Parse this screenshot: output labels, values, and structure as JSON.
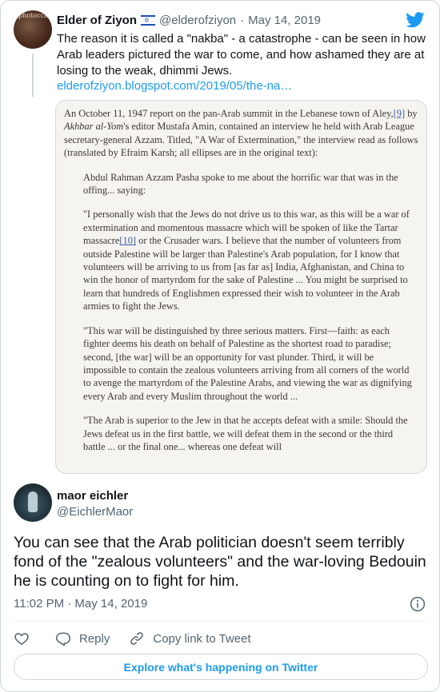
{
  "quoted": {
    "name": "Elder of Ziyon",
    "handle": "@elderofziyon",
    "separator": "·",
    "date": "May 14, 2019",
    "text": "The reason it is called a \"nakba\" - a catastrophe - can be seen in how Arab leaders pictured the war to come, and how ashamed they are at losing to the weak, dhimmi Jews.",
    "link": "elderofziyon.blogspot.com/2019/05/the-na…",
    "avatar_mark": "photocca"
  },
  "media": {
    "intro_a": "An October 11, 1947 report on the pan-Arab summit in the Lebanese town of Aley,",
    "intro_fn": "[9]",
    "intro_b": " by ",
    "intro_pub": "Akhbar al-Yom",
    "intro_c": "'s editor Mustafa Amin, contained an interview he held with Arab League secretary-general Azzam. Titled, \"A War of Extermination,\" the interview read as follows (translated by Efraim Karsh; all ellipses are in the original text):",
    "p1": "Abdul Rahman Azzam Pasha spoke to me about the horrific war that was in the offing... saying:",
    "p2a": "\"I personally wish that the Jews do not drive us to this war, as this will be a war of extermination and momentous massacre which will be spoken of like the Tartar massacre",
    "p2fn": "[10]",
    "p2b": " or the Crusader wars. I believe that the number of volunteers from outside Palestine will be larger than Palestine's Arab population, for I know that volunteers will be arriving to us from [as far as] India, Afghanistan, and China to win the honor of martyrdom for the sake of Palestine ... You might be surprised to learn that hundreds of Englishmen expressed their wish to volunteer in the Arab armies to fight the Jews.",
    "p3": "\"This war will be distinguished by three serious matters. First—faith: as each fighter deems his death on behalf of Palestine as the shortest road to paradise; second, [the war] will be an opportunity for vast plunder. Third, it will be impossible to contain the zealous volunteers arriving from all corners of the world to avenge the martyrdom of the Palestine Arabs, and viewing the war as dignifying every Arab and every Muslim throughout the world ...",
    "p4": "\"The Arab is superior to the Jew in that he accepts defeat with a smile: Should the Jews defeat us in the first battle, we will defeat them in the second or the third battle ... or the final one... whereas one defeat will"
  },
  "reply": {
    "name": "maor eichler",
    "handle": "@EichlerMaor",
    "text": "You can see that the Arab politician doesn't seem terribly fond of the \"zealous volunteers\" and the war-loving Bedouin he is counting on to fight for him.",
    "timestamp": "11:02 PM · May 14, 2019"
  },
  "actions": {
    "reply_label": "Reply",
    "copy_label": "Copy link to Tweet"
  },
  "explore_label": "Explore what's happening on Twitter",
  "icons": [
    "twitter-bird-icon",
    "israel-flag-icon",
    "info-icon",
    "heart-icon",
    "reply-icon",
    "link-icon"
  ],
  "colors": {
    "accent": "#1d9bf0",
    "muted": "#536471",
    "border": "#cfd9de"
  }
}
